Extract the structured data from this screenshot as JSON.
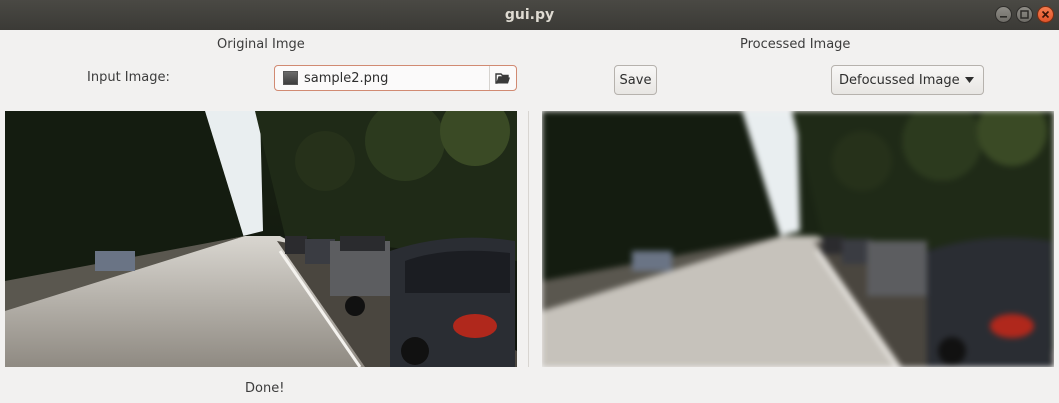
{
  "window": {
    "title": "gui.py"
  },
  "left_panel": {
    "heading": "Original Imge",
    "input_label": "Input Image:",
    "file_chooser": {
      "value": "sample2.png",
      "icon": "folder-open-icon"
    },
    "image": {
      "description_icon": "photo-street-scene"
    },
    "status": "Done!"
  },
  "right_panel": {
    "heading": "Processed Image",
    "save_label": "Save",
    "mode_select": {
      "selected": "Defocussed Image"
    },
    "image": {
      "description_icon": "photo-street-scene-blurred"
    }
  },
  "colors": {
    "titlebar": "#3b3a36",
    "close_button": "#e2542a",
    "file_field_border": "#d18a72",
    "window_bg": "#f2f1f0"
  }
}
